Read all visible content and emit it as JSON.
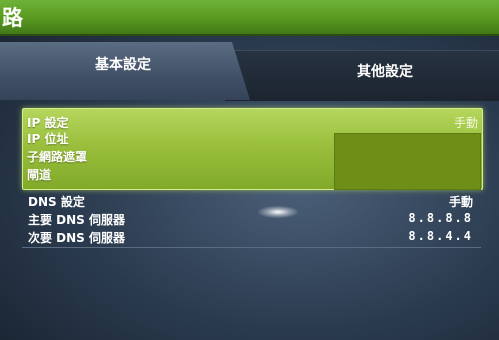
{
  "window": {
    "title": "路"
  },
  "tabs": [
    {
      "label": "基本設定",
      "active": true
    },
    {
      "label": "其他設定",
      "active": false
    }
  ],
  "ip_settings": {
    "label": "IP 設定",
    "value": "手動",
    "fields": [
      {
        "label": "IP 位址"
      },
      {
        "label": "子網路遮罩"
      },
      {
        "label": "閘道"
      }
    ]
  },
  "dns_settings": {
    "label": "DNS 設定",
    "value": "手動",
    "primary_label": "主要 DNS 伺服器",
    "primary_value": "8.8.8.8",
    "secondary_label": "次要 DNS 伺服器",
    "secondary_value": "8.8.4.4"
  },
  "colors": {
    "accent_green": "#97bd3a",
    "title_green": "#58991f",
    "background": "#2a3a4e"
  }
}
